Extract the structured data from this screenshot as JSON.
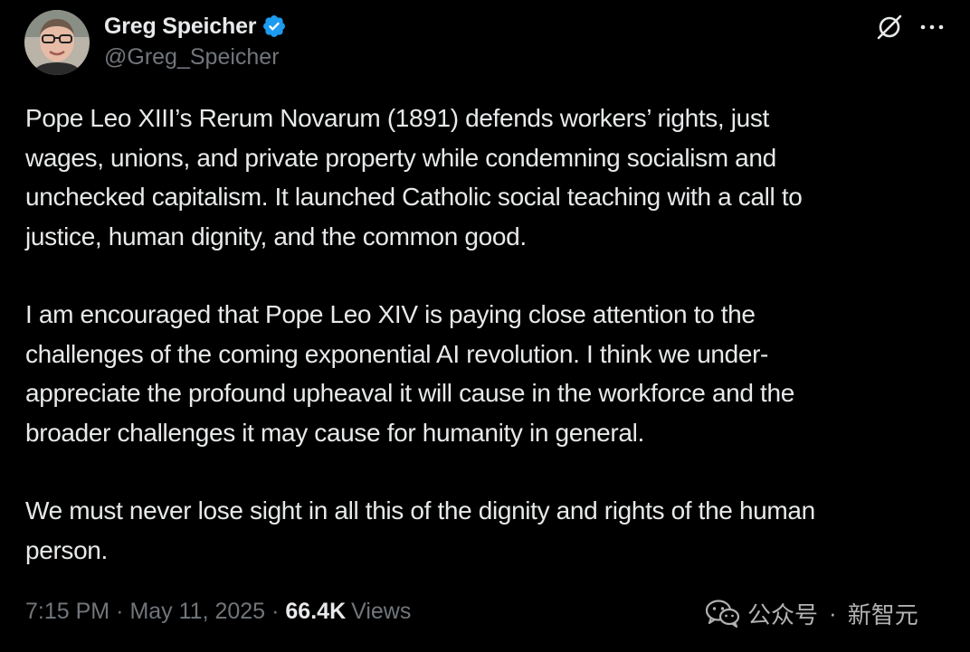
{
  "author": {
    "display_name": "Greg Speicher",
    "handle": "@Greg_Speicher",
    "verified": true
  },
  "tweet": {
    "paragraphs": [
      "Pope Leo XIII’s Rerum Novarum (1891) defends workers’ rights, just\nwages, unions, and private property while condemning socialism and\nunchecked capitalism. It launched Catholic social teaching with a call to\njustice, human dignity, and the common good.",
      "I am encouraged that Pope Leo XIV is paying close attention to the\nchallenges of the coming exponential AI revolution. I think we under-\nappreciate the profound upheaval it will cause in the workforce and the\nbroader challenges it may cause for humanity in general.",
      "We must never lose sight in all this of the dignity and rights of the human\nperson."
    ]
  },
  "meta": {
    "time": "7:15 PM",
    "separator": "·",
    "date": "May 11, 2025",
    "views_count": "66.4K",
    "views_label": "Views"
  },
  "watermark": {
    "text": "公众号",
    "separator": "·",
    "brand": "新智元",
    "icon": "wechat-icon"
  },
  "colors": {
    "background": "#000000",
    "primary_text": "#e7e9ea",
    "secondary_text": "#71767b",
    "verified_badge": "#1d9bf0"
  }
}
